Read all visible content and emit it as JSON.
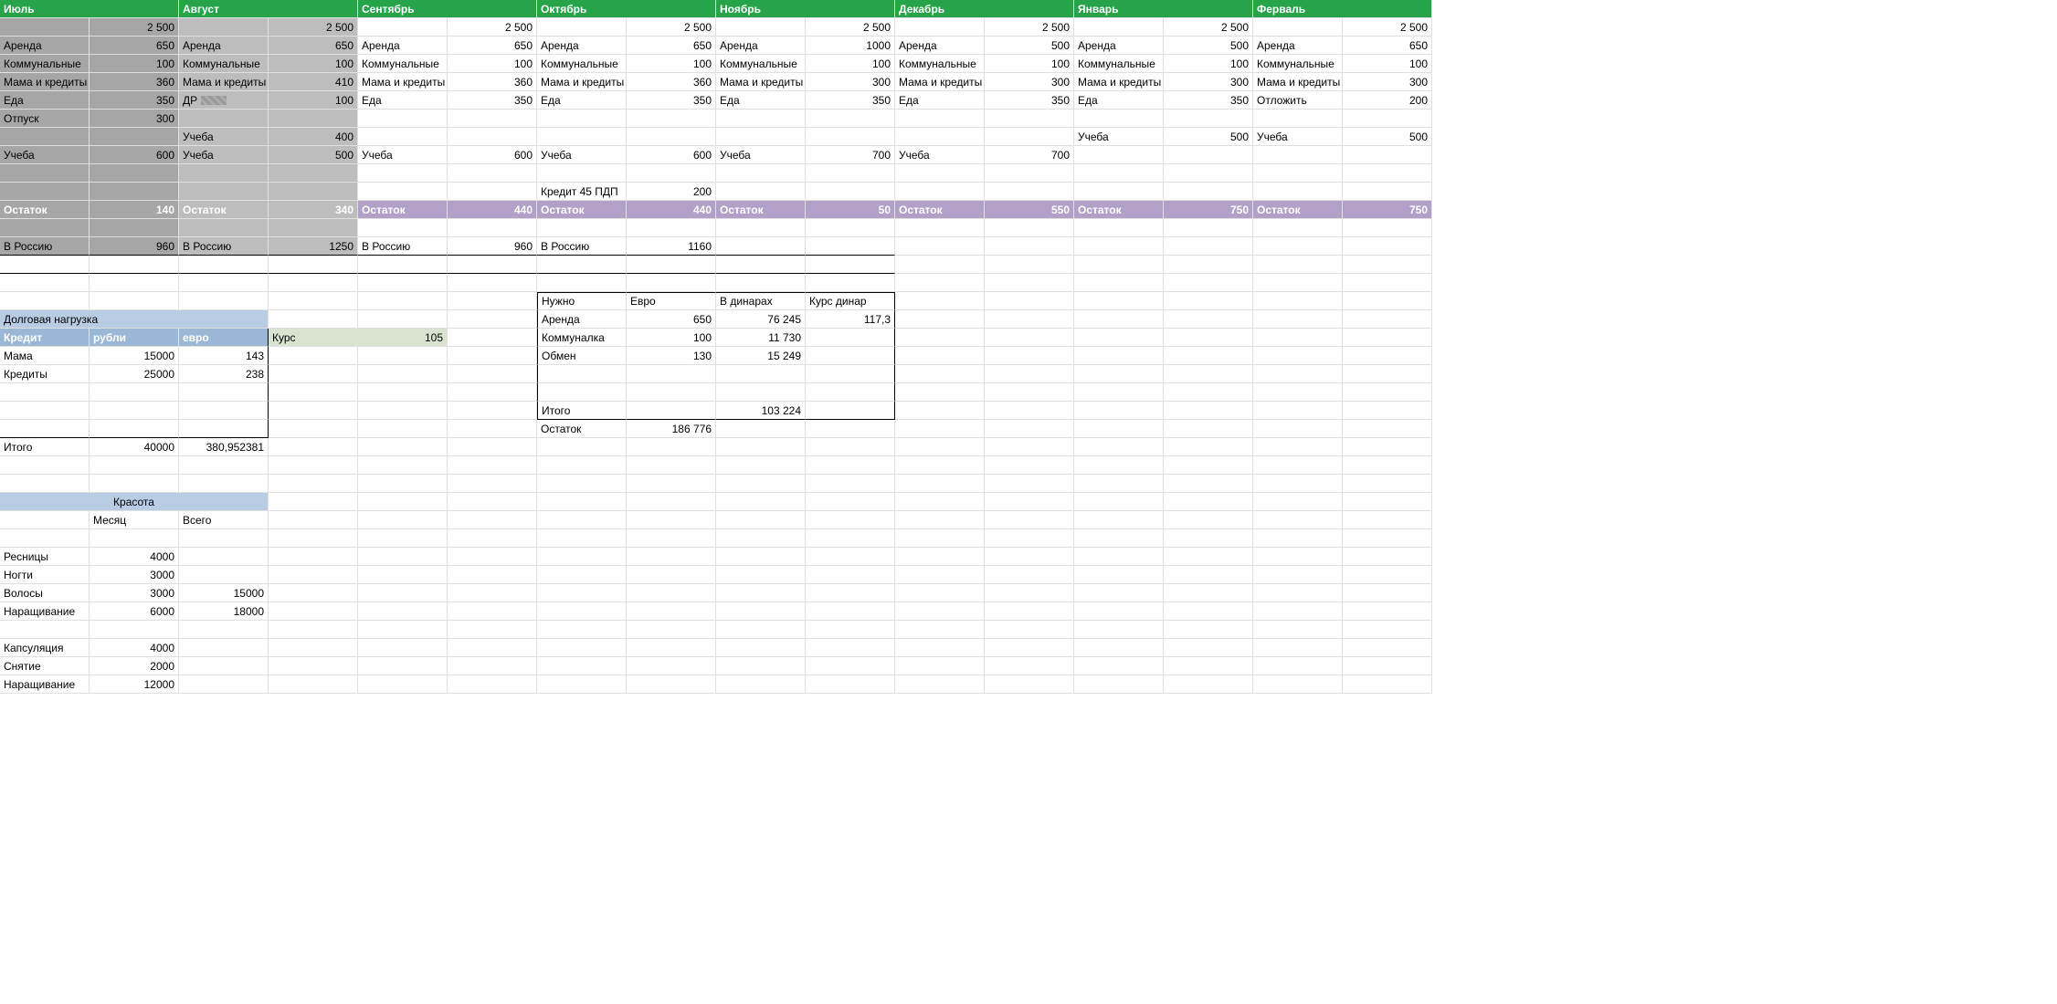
{
  "months": [
    "Июль",
    "Август",
    "Сентябрь",
    "Октябрь",
    "Ноябрь",
    "Декабрь",
    "Январь",
    "Ферваль"
  ],
  "income": [
    2500,
    2500,
    2500,
    2500,
    2500,
    2500,
    2500,
    2500
  ],
  "rows": {
    "rent": {
      "l": "Аренда",
      "v": [
        650,
        650,
        650,
        650,
        1000,
        500,
        500,
        650
      ]
    },
    "util": {
      "l": "Коммунальные",
      "v": [
        100,
        100,
        100,
        100,
        100,
        100,
        100,
        100
      ]
    },
    "momcr": {
      "l": "Мама и кредиты",
      "v": [
        360,
        410,
        360,
        360,
        300,
        300,
        300,
        300
      ]
    },
    "food_l": {
      "jul": "Еда",
      "aug": "ДР",
      "sep": "Еда",
      "oct": "Еда",
      "nov": "Еда",
      "dec": "Еда",
      "jan": "Еда",
      "feb": "Отложить"
    },
    "food_v": [
      350,
      100,
      350,
      350,
      350,
      350,
      350,
      200
    ],
    "vac": {
      "l": "Отпуск",
      "v": 300
    },
    "studyA": {
      "l": "Учеба",
      "v_aug": 400,
      "v_jan": 500,
      "v_feb": 500
    },
    "studyB": {
      "l": "Учеба",
      "v": [
        600,
        500,
        600,
        600,
        700,
        700
      ]
    },
    "credit45": {
      "l": "Кредит 45 ПДП",
      "v": 200
    },
    "balance": {
      "l": "Остаток",
      "v": [
        140,
        340,
        440,
        440,
        50,
        550,
        750,
        750
      ]
    },
    "russia": {
      "l": "В Россию",
      "v": [
        960,
        1250,
        960,
        1160
      ]
    }
  },
  "debt": {
    "title": "Долговая нагрузка",
    "hdr": [
      "Кредит",
      "рубли",
      "евро"
    ],
    "rate_l": "Курс",
    "rate_v": 105,
    "r1": {
      "l": "Мама",
      "rub": 15000,
      "eur": 143
    },
    "r2": {
      "l": "Кредиты",
      "rub": 25000,
      "eur": 238
    },
    "total_l": "Итого",
    "total_rub": 40000,
    "total_eur": "380,952381"
  },
  "need": {
    "hdr": [
      "Нужно",
      "Евро",
      "В динарах",
      "Курс динар"
    ],
    "r1": {
      "l": "Аренда",
      "eur": 650,
      "din": "76 245",
      "rate": "117,3"
    },
    "r2": {
      "l": "Коммуналка",
      "eur": 100,
      "din": "11 730"
    },
    "r3": {
      "l": "Обмен",
      "eur": 130,
      "din": "15 249"
    },
    "total_l": "Итого",
    "total_din": "103 224",
    "rest_l": "Остаток",
    "rest_eur": "186 776"
  },
  "beauty": {
    "title": "Красота",
    "hdr": [
      "Месяц",
      "Всего"
    ],
    "r1": {
      "l": "Ресницы",
      "m": 4000
    },
    "r2": {
      "l": "Ногти",
      "m": 3000
    },
    "r3": {
      "l": "Волосы",
      "m": 3000,
      "t": 15000
    },
    "r4": {
      "l": "Наращивание",
      "m": 6000,
      "t": 18000
    },
    "r5": {
      "l": "Капсуляция",
      "m": 4000
    },
    "r6": {
      "l": "Снятие",
      "m": 2000
    },
    "r7": {
      "l": "Наращивание",
      "m": 12000
    }
  },
  "fmt_income": "2 500"
}
